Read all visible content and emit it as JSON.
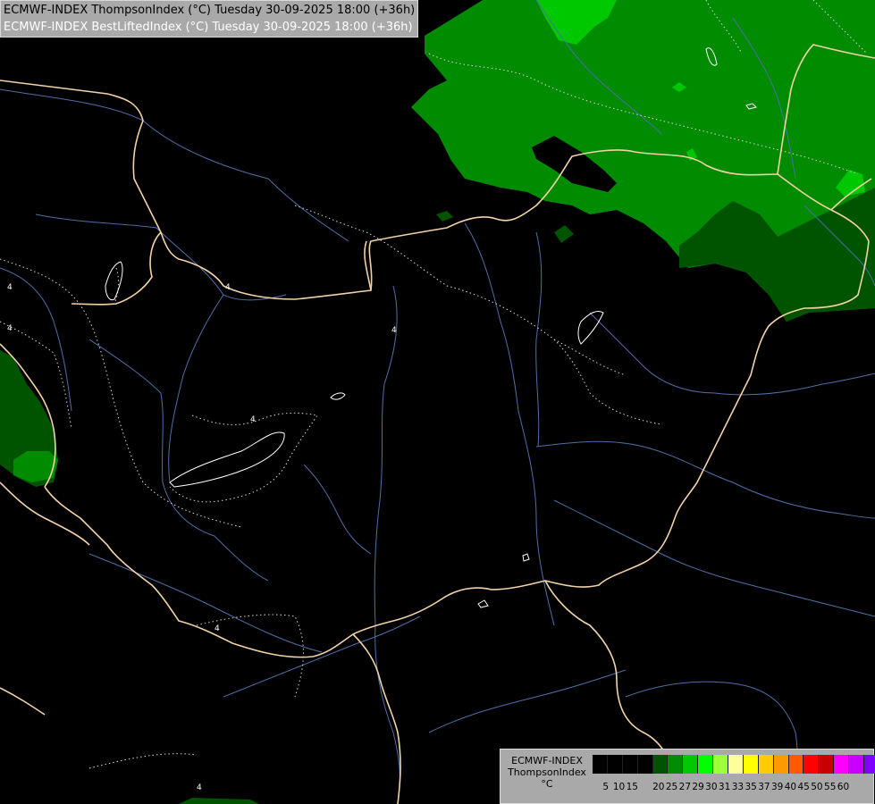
{
  "title": {
    "line1": "ECMWF-INDEX ThompsonIndex (°C) Tuesday 30-09-2025 18:00 (+36h)",
    "line2": "ECMWF-INDEX BestLiftedIndex (°C) Tuesday 30-09-2025 18:00 (+36h)"
  },
  "contour_labels": [
    "4",
    "4",
    "4",
    "4",
    "4",
    "4",
    "4"
  ],
  "legend": {
    "model": "ECMWF-INDEX",
    "parameter": "ThompsonIndex",
    "unit": "°C",
    "colors": [
      "#000000",
      "#000000",
      "#000000",
      "#000000",
      "#005400",
      "#008b00",
      "#00c800",
      "#00ff00",
      "#a0ff3c",
      "#ffff9a",
      "#ffff00",
      "#ffcc00",
      "#ff9900",
      "#ff5a00",
      "#ff0000",
      "#c80000",
      "#ff00ff",
      "#c800ff",
      "#8000ff",
      "#4b00ff",
      "#0000ff"
    ],
    "ticks": [
      "5",
      "10",
      "15",
      "20",
      "25",
      "27",
      "29",
      "30",
      "31",
      "33",
      "35",
      "37",
      "39",
      "40",
      "45",
      "50",
      "55",
      "60"
    ]
  },
  "colors": {
    "green_dark": "#005400",
    "green_mid": "#008b00",
    "green_light": "#00c800",
    "border": "#f2d3a8",
    "river": "#4f6fa8"
  }
}
